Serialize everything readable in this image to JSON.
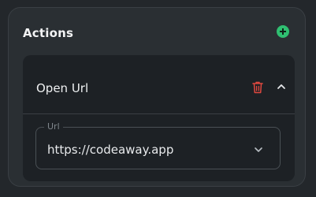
{
  "actions": {
    "title": "Actions",
    "add_icon": "plus-circle-icon",
    "accent_color": "#2fbf71",
    "items": [
      {
        "title": "Open Url",
        "delete_icon": "trash-icon",
        "delete_color": "#e0483f",
        "collapse_icon": "chevron-up-icon",
        "field": {
          "label": "Url",
          "value": "https://codeaway.app",
          "dropdown_icon": "chevron-down-icon"
        }
      }
    ]
  }
}
